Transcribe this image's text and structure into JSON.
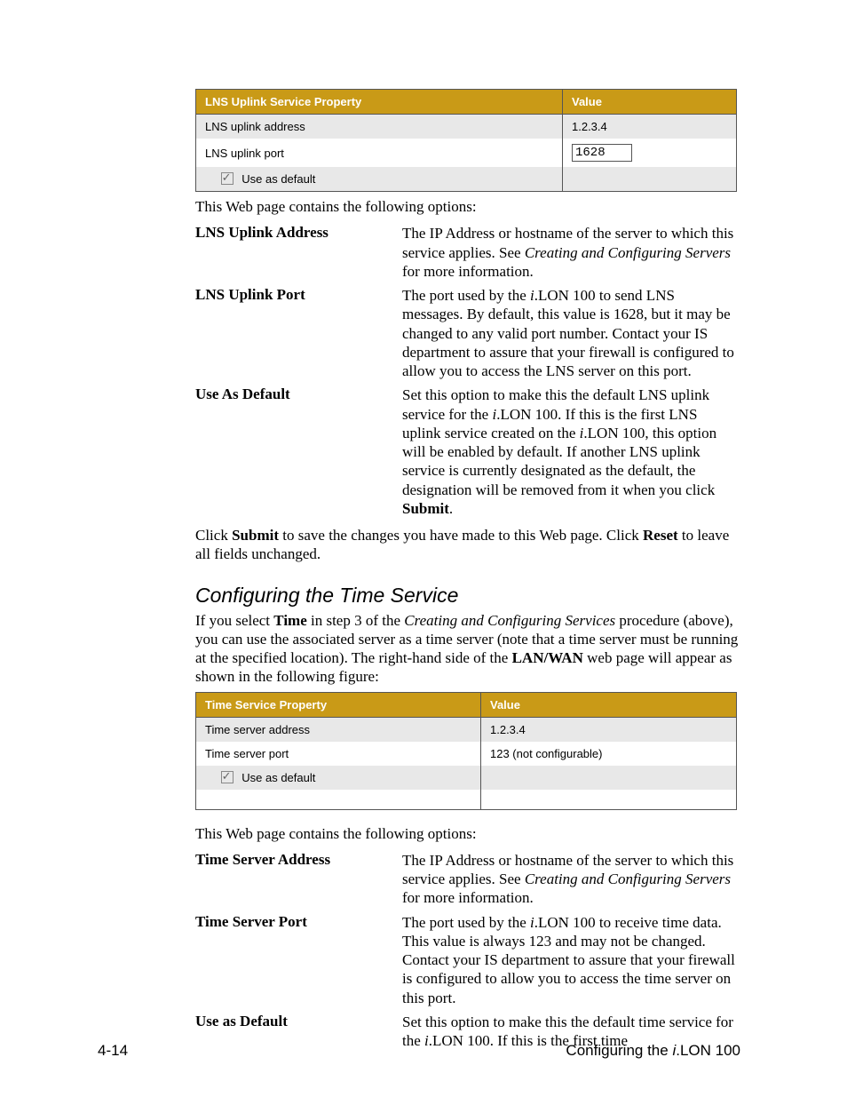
{
  "table1": {
    "head_prop": "LNS Uplink Service Property",
    "head_val": "Value",
    "r1_label": "LNS uplink address",
    "r1_val": "1.2.3.4",
    "r2_label": "LNS uplink port",
    "r2_val": "1628",
    "r3_label": "Use as default"
  },
  "intro1": "This Web page contains the following options:",
  "defs1": {
    "a_label": "LNS Uplink Address",
    "a_body_1": "The IP Address or hostname of the server to which this service applies.  See ",
    "a_body_em": "Creating and Configuring Servers",
    "a_body_2": " for more information.",
    "b_label": "LNS Uplink Port",
    "b_body_1": "The port used by the ",
    "b_body_em": "i",
    "b_body_2": ".LON 100 to send LNS messages.  By default, this value is 1628, but it may be changed to any valid port number.  Contact your IS department to assure that your firewall is configured to allow you to access the LNS server on this port.",
    "c_label": "Use As Default",
    "c_body_1": "Set this option to make this the default LNS uplink service for the ",
    "c_body_em1": "i",
    "c_body_2": ".LON 100.  If this is the first LNS uplink service created on the ",
    "c_body_em2": "i",
    "c_body_3": ".LON 100, this option will be enabled by default.  If another LNS uplink service is currently designated as the default, the designation will be removed from it when you click ",
    "c_body_strong": "Submit",
    "c_body_4": "."
  },
  "submit_para_1": "Click ",
  "submit_strong1": "Submit",
  "submit_para_2": " to save the changes you have made to this Web page.  Click ",
  "submit_strong2": "Reset",
  "submit_para_3": " to leave all fields unchanged.",
  "section_title": "Configuring the Time Service",
  "time_para_1": "If you select ",
  "time_strong1": "Time",
  "time_para_2": " in step 3 of the ",
  "time_em1": "Creating and Configuring Services",
  "time_para_3": " procedure (above), you can use the associated server as a time server (note that a time server must be running at the specified location).  The right-hand side of the ",
  "time_strong2": "LAN/WAN",
  "time_para_4": " web page will appear as shown in the following figure:",
  "table2": {
    "head_prop": "Time Service Property",
    "head_val": "Value",
    "r1_label": "Time server address",
    "r1_val": "1.2.3.4",
    "r2_label": "Time server port",
    "r2_val": "123 (not configurable)",
    "r3_label": "Use as default"
  },
  "intro2": "This Web page contains the following options:",
  "defs2": {
    "a_label": "Time Server Address",
    "a_body_1": "The IP Address or hostname of the server to which this service applies.  See ",
    "a_body_em": "Creating and Configuring Servers",
    "a_body_2": " for more information.",
    "b_label": "Time Server Port",
    "b_body_1": "The port used by the ",
    "b_body_em": "i",
    "b_body_2": ".LON 100 to receive time data.  This value is always 123 and may not be changed.  Contact your IS department to assure that your firewall is configured to allow you to access the time server on this port.",
    "c_label": "Use as Default",
    "c_body_1": "Set this option to make this the default time service for the ",
    "c_body_em": "i",
    "c_body_2": ".LON 100.  If this is the first time"
  },
  "footer_left": "4-14",
  "footer_right_1": "Configuring the ",
  "footer_right_em": "i",
  "footer_right_2": ".LON 100"
}
